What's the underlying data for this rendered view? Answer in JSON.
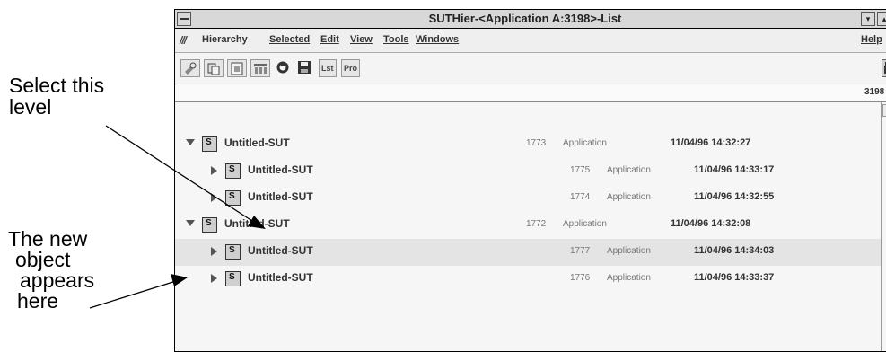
{
  "annotations": {
    "select_level": [
      "Select this",
      "level"
    ],
    "new_object": [
      "The new",
      "object",
      "appears",
      "here"
    ]
  },
  "window": {
    "title": "SUTHier-<Application A:3198>-List",
    "minimize_glyph": "▾",
    "restore_glyph": "▴"
  },
  "menubar": {
    "glyph": "///",
    "items": [
      "Hierarchy",
      "Selected",
      "Edit",
      "View",
      "Tools",
      "Windows",
      "Help"
    ]
  },
  "toolbar": {
    "buttons": [
      "copy-tool-icon",
      "paste-icon",
      "clipboard-icon",
      "tree-icon",
      "refresh-icon",
      "save-icon"
    ],
    "text_buttons": [
      "Lst",
      "Pro"
    ]
  },
  "status": {
    "value": "3198"
  },
  "rows": [
    {
      "expanded": true,
      "name": "Untitled-SUT",
      "id": "1773",
      "type": "Application",
      "date": "11/04/96 14:32:27"
    },
    {
      "expanded": false,
      "name": "Untitled-SUT",
      "id": "1775",
      "type": "Application",
      "date": "11/04/96 14:33:17"
    },
    {
      "expanded": false,
      "name": "Untitled-SUT",
      "id": "1774",
      "type": "Application",
      "date": "11/04/96 14:32:55"
    },
    {
      "expanded": true,
      "name": "Untitled-SUT",
      "id": "1772",
      "type": "Application",
      "date": "11/04/96 14:32:08"
    },
    {
      "expanded": false,
      "name": "Untitled-SUT",
      "id": "1777",
      "type": "Application",
      "date": "11/04/96 14:34:03",
      "selected": true
    },
    {
      "expanded": false,
      "name": "Untitled-SUT",
      "id": "1776",
      "type": "Application",
      "date": "11/04/96 14:33:37"
    }
  ]
}
